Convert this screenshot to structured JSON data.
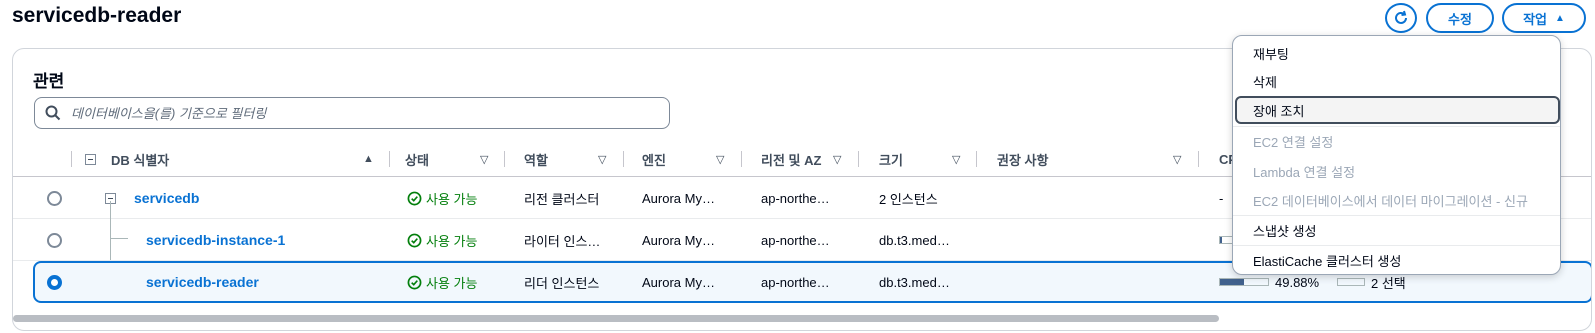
{
  "page_title": "servicedb-reader",
  "header_buttons": {
    "refresh_icon": "refresh-icon",
    "edit_label": "수정",
    "actions_label": "작업"
  },
  "card": {
    "title": "관련",
    "search_placeholder": "데이터베이스을(를) 기준으로 필터링"
  },
  "columns": {
    "db_id": "DB 식별자",
    "status": "상태",
    "role": "역할",
    "engine": "엔진",
    "region": "리전 및 AZ",
    "size": "크기",
    "recommendations": "권장 사항",
    "cpu": "CPU"
  },
  "rows": [
    {
      "id": "servicedb",
      "status": "사용 가능",
      "role": "리전 클러스터",
      "engine": "Aurora My…",
      "region": "ap-northe…",
      "size": "2 인스턴스",
      "cpu_text": "-",
      "selected": false
    },
    {
      "id": "servicedb-instance-1",
      "status": "사용 가능",
      "role": "라이터 인스…",
      "engine": "Aurora My…",
      "region": "ap-northe…",
      "size": "db.t3.med…",
      "cpu_text": "",
      "selected": false
    },
    {
      "id": "servicedb-reader",
      "status": "사용 가능",
      "role": "리더 인스턴스",
      "engine": "Aurora My…",
      "region": "ap-northe…",
      "size": "db.t3.med…",
      "cpu_text": "49.88%",
      "cpu_fraction": 0.4988,
      "extra": "2 선택",
      "selected": true
    }
  ],
  "actions_menu": [
    {
      "label": "재부팅",
      "disabled": false
    },
    {
      "label": "삭제",
      "disabled": false
    },
    {
      "label": "장애 조치",
      "disabled": false,
      "focused": true
    },
    {
      "label": "EC2 연결 설정",
      "disabled": true
    },
    {
      "label": "Lambda 연결 설정",
      "disabled": true
    },
    {
      "label": "EC2 데이터베이스에서 데이터 마이그레이션 - 신규",
      "disabled": true
    },
    {
      "label": "스냅샷 생성",
      "disabled": false
    },
    {
      "label": "ElastiCache 클러스터 생성",
      "disabled": false
    }
  ],
  "colors": {
    "accent": "#0972d3",
    "status_ok": "#037f0c"
  }
}
